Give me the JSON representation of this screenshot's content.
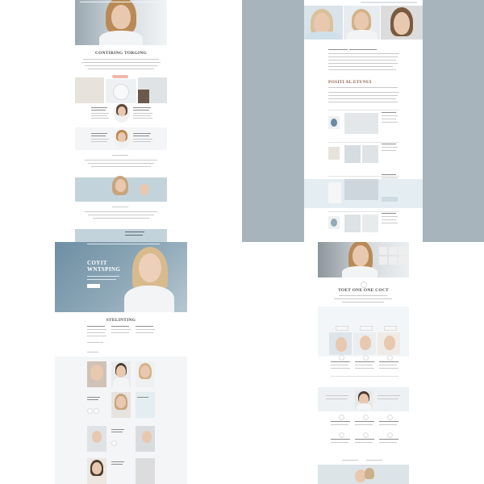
{
  "panel1": {
    "heading": "CONTIRING TORGING"
  },
  "panel2": {
    "heading": "POSITI AL ETUNUI"
  },
  "panel3": {
    "hero_title": "COYIT WNTSPING",
    "section_heading": "STELINTING"
  },
  "panel4": {
    "heading": "TOET ONE ONE COCT"
  },
  "colors": {
    "blue_grey": "#a7b4bb",
    "pale_blue": "#c3d3dc",
    "skin": "#e9c8b0",
    "hair": "#b98a55",
    "coat": "#f3f4f5"
  },
  "icons": [
    "avatar-icon",
    "placeholder-circle-icon"
  ]
}
